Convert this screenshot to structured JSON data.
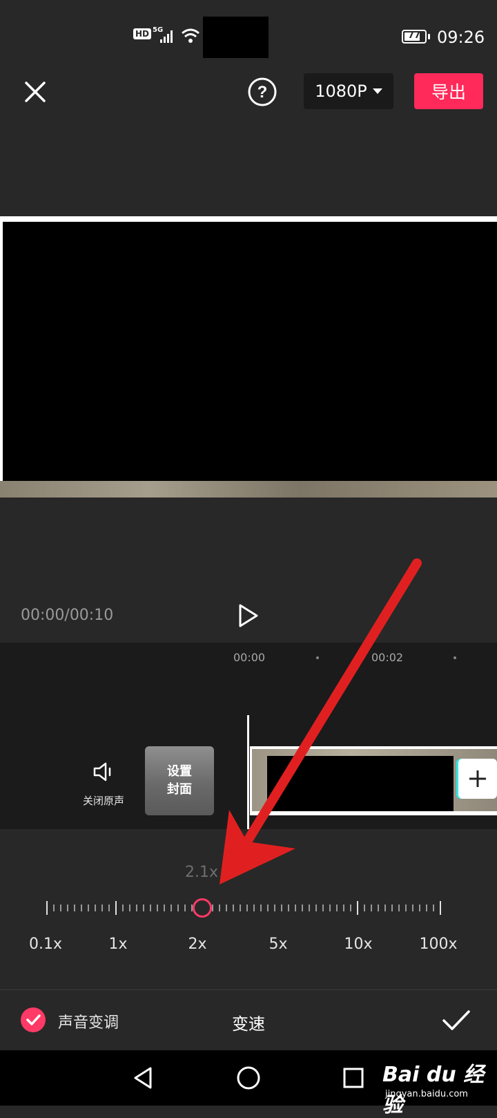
{
  "status_bar": {
    "hd": "HD",
    "network": "5G",
    "battery": "77",
    "battery_level": 0.77,
    "time": "09:26"
  },
  "toolbar": {
    "resolution": "1080P",
    "export_label": "导出"
  },
  "player": {
    "timecode": "00:00/00:10"
  },
  "timeline": {
    "marks": [
      "00:00",
      "00:02"
    ],
    "mute_label": "关闭原声",
    "cover_label_line1": "设置",
    "cover_label_line2": "封面"
  },
  "speed": {
    "current": "2.1x",
    "labels": [
      "0.1x",
      "1x",
      "2x",
      "5x",
      "10x",
      "100x"
    ]
  },
  "bottom_bar": {
    "pitch_label": "声音变调",
    "pitch_checked": true,
    "title": "变速"
  },
  "watermark": {
    "brand": "Bai du 经验",
    "url": "jingyan.baidu.com"
  },
  "colors": {
    "accent": "#ff2a5a",
    "annotation": "#e02020"
  }
}
